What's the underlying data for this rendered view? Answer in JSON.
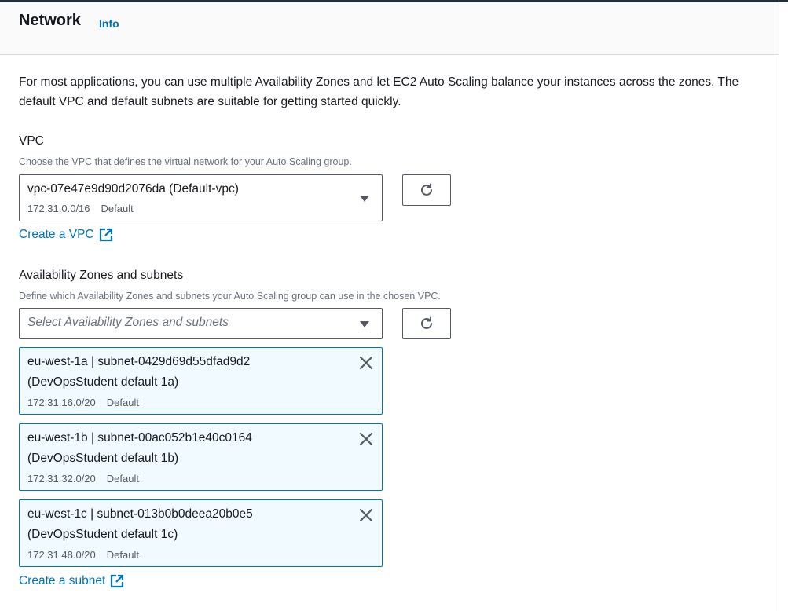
{
  "header": {
    "title": "Network",
    "info": "Info"
  },
  "intro": "For most applications, you can use multiple Availability Zones and let EC2 Auto Scaling balance your instances across the zones. The default VPC and default subnets are suitable for getting started quickly.",
  "vpc": {
    "label": "VPC",
    "description": "Choose the VPC that defines the virtual network for your Auto Scaling group.",
    "selected": "vpc-07e47e9d90d2076da (Default-vpc)",
    "cidr": "172.31.0.0/16",
    "tag": "Default",
    "create_link": "Create a VPC"
  },
  "subnets": {
    "label": "Availability Zones and subnets",
    "description": "Define which Availability Zones and subnets your Auto Scaling group can use in the chosen VPC.",
    "placeholder": "Select Availability Zones and subnets",
    "tokens": [
      {
        "line1": "eu-west-1a | subnet-0429d69d55dfad9d2",
        "line2": "(DevOpsStudent default 1a)",
        "cidr": "172.31.16.0/20",
        "tag": "Default"
      },
      {
        "line1": "eu-west-1b | subnet-00ac052b1e40c0164",
        "line2": "(DevOpsStudent default 1b)",
        "cidr": "172.31.32.0/20",
        "tag": "Default"
      },
      {
        "line1": "eu-west-1c | subnet-013b0b0deea20b0e5",
        "line2": "(DevOpsStudent default 1c)",
        "cidr": "172.31.48.0/20",
        "tag": "Default"
      }
    ],
    "create_link": "Create a subnet"
  },
  "icons": {
    "refresh": "refresh-icon",
    "external": "external-link-icon",
    "remove": "close-icon",
    "caret": "caret-down-icon"
  },
  "colors": {
    "link": "#0073bb",
    "token_bg": "#f1faff",
    "text": "#16191f",
    "muted": "#687078"
  }
}
